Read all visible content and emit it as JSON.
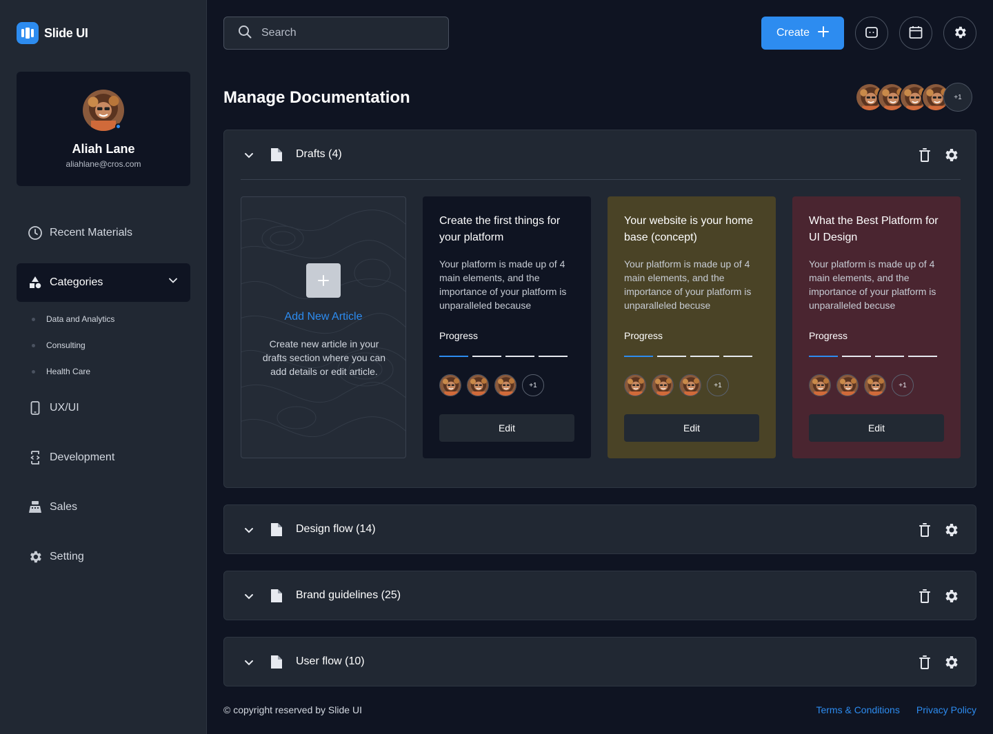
{
  "brand": {
    "name": "Slide UI"
  },
  "profile": {
    "name": "Aliah Lane",
    "email": "aliahlane@cros.com"
  },
  "sidebar": {
    "recent": "Recent Materials",
    "categories": {
      "label": "Categories",
      "items": [
        "Data and Analytics",
        "Consulting",
        "Health Care"
      ]
    },
    "items": [
      "UX/UI",
      "Development",
      "Sales",
      "Setting"
    ]
  },
  "header": {
    "search_placeholder": "Search",
    "create_label": "Create",
    "team_more": "+1"
  },
  "page": {
    "title": "Manage Documentation"
  },
  "sections": [
    {
      "title": "Drafts (4)",
      "expanded": true
    },
    {
      "title": "Design flow (14)",
      "expanded": false
    },
    {
      "title": "Brand guidelines (25)",
      "expanded": false
    },
    {
      "title": "User flow (10)",
      "expanded": false
    }
  ],
  "add_article": {
    "title": "Add New Article",
    "description": "Create new article in your drafts section where you can add details or edit article."
  },
  "articles": [
    {
      "title": "Create the first things for your platform",
      "description": "Your platform is made up of 4 main elements, and the importance of your platform is unparalleled because",
      "progress_label": "Progress",
      "progress_steps_done": 1,
      "progress_steps_total": 4,
      "more": "+1",
      "edit_label": "Edit",
      "bg": "#0f1422"
    },
    {
      "title": "Your website is your home base (concept)",
      "description": "Your platform is made up of 4 main elements, and the importance of your platform is unparalleled becuse",
      "progress_label": "Progress",
      "progress_steps_done": 1,
      "progress_steps_total": 4,
      "more": "+1",
      "edit_label": "Edit",
      "bg": "#4a4326"
    },
    {
      "title": "What the Best Platform for UI Design",
      "description": "Your platform is made up of 4 main elements, and the importance of your platform is unparalleled becuse",
      "progress_label": "Progress",
      "progress_steps_done": 1,
      "progress_steps_total": 4,
      "more": "+1",
      "edit_label": "Edit",
      "bg": "#4a2530"
    }
  ],
  "footer": {
    "copyright": "© copyright reserved by Slide UI",
    "terms": "Terms & Conditions",
    "privacy": "Privacy Policy"
  },
  "colors": {
    "accent": "#2d8cf0",
    "sidebar_bg": "#212833",
    "page_bg": "#0f1422"
  }
}
